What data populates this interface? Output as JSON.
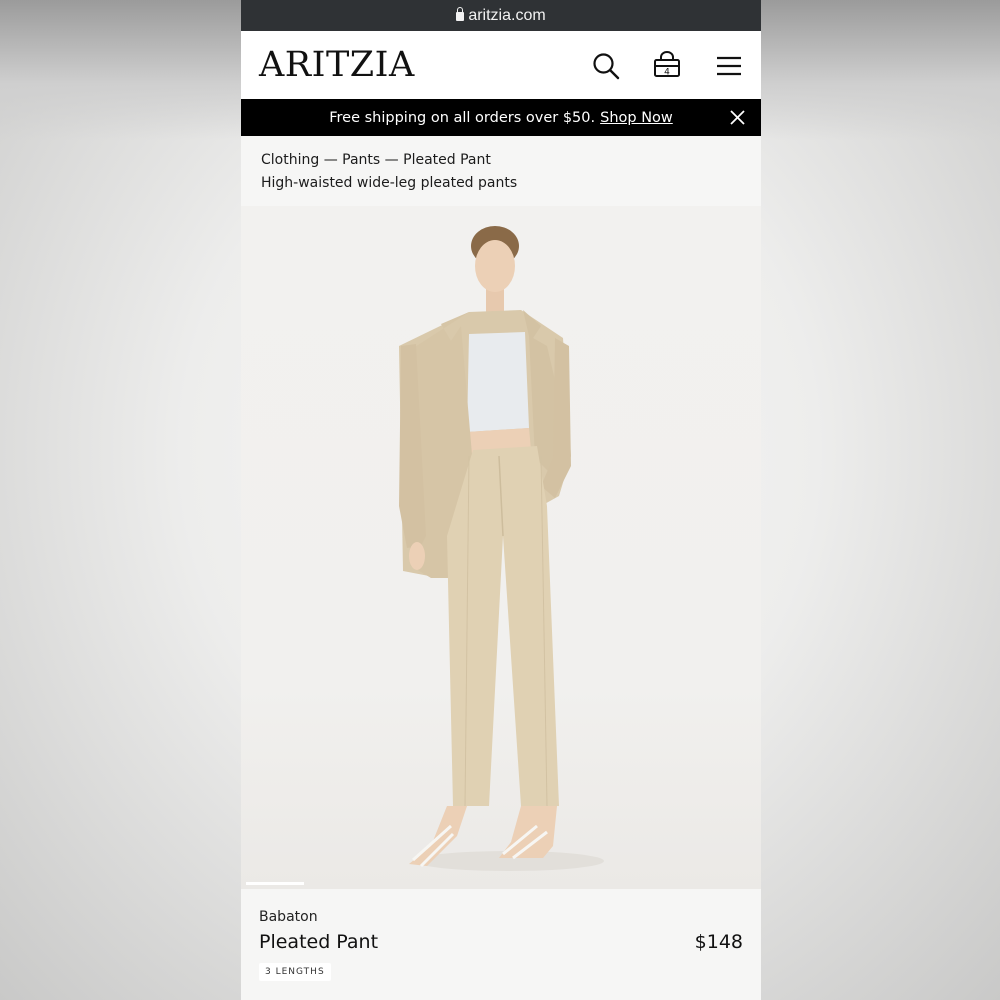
{
  "browser": {
    "url": "aritzia.com"
  },
  "header": {
    "logo": "ARITZIA",
    "bag_count": "4"
  },
  "promo": {
    "text": "Free shipping on all orders over $50.",
    "link": "Shop Now"
  },
  "breadcrumb": {
    "items": [
      "Clothing",
      "Pants",
      "Pleated Pant"
    ],
    "separator": " — ",
    "subtitle": "High-waisted wide-leg pleated pants"
  },
  "product": {
    "brand": "Babaton",
    "name": "Pleated Pant",
    "price": "$148",
    "badge": "3 LENGTHS"
  },
  "colors": {
    "url_bar": "#2f3235",
    "promo_bar": "#000000",
    "garment": "#d9c8a8",
    "top": "#e8ebee"
  }
}
